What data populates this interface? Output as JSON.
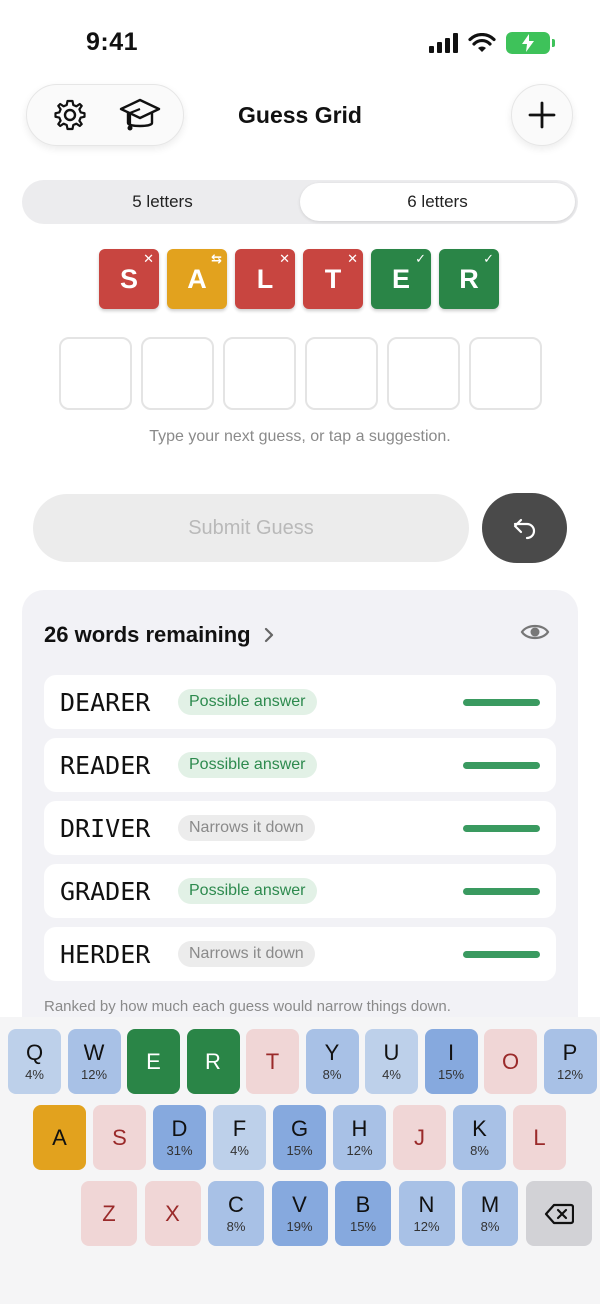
{
  "status_bar": {
    "time": "9:41"
  },
  "header": {
    "title": "Guess Grid"
  },
  "segments": [
    {
      "label": "5 letters",
      "active": false
    },
    {
      "label": "6 letters",
      "active": true
    }
  ],
  "guess": [
    {
      "letter": "S",
      "state": "absent",
      "mark": "✕"
    },
    {
      "letter": "A",
      "state": "misplaced",
      "mark": "⇆"
    },
    {
      "letter": "L",
      "state": "absent",
      "mark": "✕"
    },
    {
      "letter": "T",
      "state": "absent",
      "mark": "✕"
    },
    {
      "letter": "E",
      "state": "correct",
      "mark": "✓"
    },
    {
      "letter": "R",
      "state": "correct",
      "mark": "✓"
    }
  ],
  "hint_text": "Type your next guess, or tap a suggestion.",
  "submit_label": "Submit Guess",
  "panel": {
    "title": "26 words remaining",
    "chevron": "›",
    "words": [
      {
        "word": "DEARER",
        "badge": "Possible answer",
        "badge_type": "possible"
      },
      {
        "word": "READER",
        "badge": "Possible answer",
        "badge_type": "possible"
      },
      {
        "word": "DRIVER",
        "badge": "Narrows it down",
        "badge_type": "narrows"
      },
      {
        "word": "GRADER",
        "badge": "Possible answer",
        "badge_type": "possible"
      },
      {
        "word": "HERDER",
        "badge": "Narrows it down",
        "badge_type": "narrows"
      }
    ],
    "footnote": "Ranked by how much each guess would narrow things down."
  },
  "keyboard": {
    "rows": [
      [
        {
          "k": "Q",
          "pct": "4%",
          "state": "b1"
        },
        {
          "k": "W",
          "pct": "12%",
          "state": "b2"
        },
        {
          "k": "E",
          "pct": "",
          "state": "green"
        },
        {
          "k": "R",
          "pct": "",
          "state": "green"
        },
        {
          "k": "T",
          "pct": "",
          "state": "absent"
        },
        {
          "k": "Y",
          "pct": "8%",
          "state": "b2"
        },
        {
          "k": "U",
          "pct": "4%",
          "state": "b1"
        },
        {
          "k": "I",
          "pct": "15%",
          "state": "b3"
        },
        {
          "k": "O",
          "pct": "",
          "state": "absent"
        },
        {
          "k": "P",
          "pct": "12%",
          "state": "b2"
        }
      ],
      [
        {
          "k": "A",
          "pct": "",
          "state": "yellow"
        },
        {
          "k": "S",
          "pct": "",
          "state": "absent"
        },
        {
          "k": "D",
          "pct": "31%",
          "state": "b3"
        },
        {
          "k": "F",
          "pct": "4%",
          "state": "b1"
        },
        {
          "k": "G",
          "pct": "15%",
          "state": "b3"
        },
        {
          "k": "H",
          "pct": "12%",
          "state": "b2"
        },
        {
          "k": "J",
          "pct": "",
          "state": "absent"
        },
        {
          "k": "K",
          "pct": "8%",
          "state": "b2"
        },
        {
          "k": "L",
          "pct": "",
          "state": "absent"
        }
      ],
      [
        {
          "k": "Z",
          "pct": "",
          "state": "absent"
        },
        {
          "k": "X",
          "pct": "",
          "state": "absent"
        },
        {
          "k": "C",
          "pct": "8%",
          "state": "b2"
        },
        {
          "k": "V",
          "pct": "19%",
          "state": "b3"
        },
        {
          "k": "B",
          "pct": "15%",
          "state": "b3"
        },
        {
          "k": "N",
          "pct": "12%",
          "state": "b2"
        },
        {
          "k": "M",
          "pct": "8%",
          "state": "b2"
        }
      ]
    ]
  },
  "colors": {
    "absent": "#c84540",
    "misplaced": "#e2a21e",
    "correct": "#2a8547"
  }
}
